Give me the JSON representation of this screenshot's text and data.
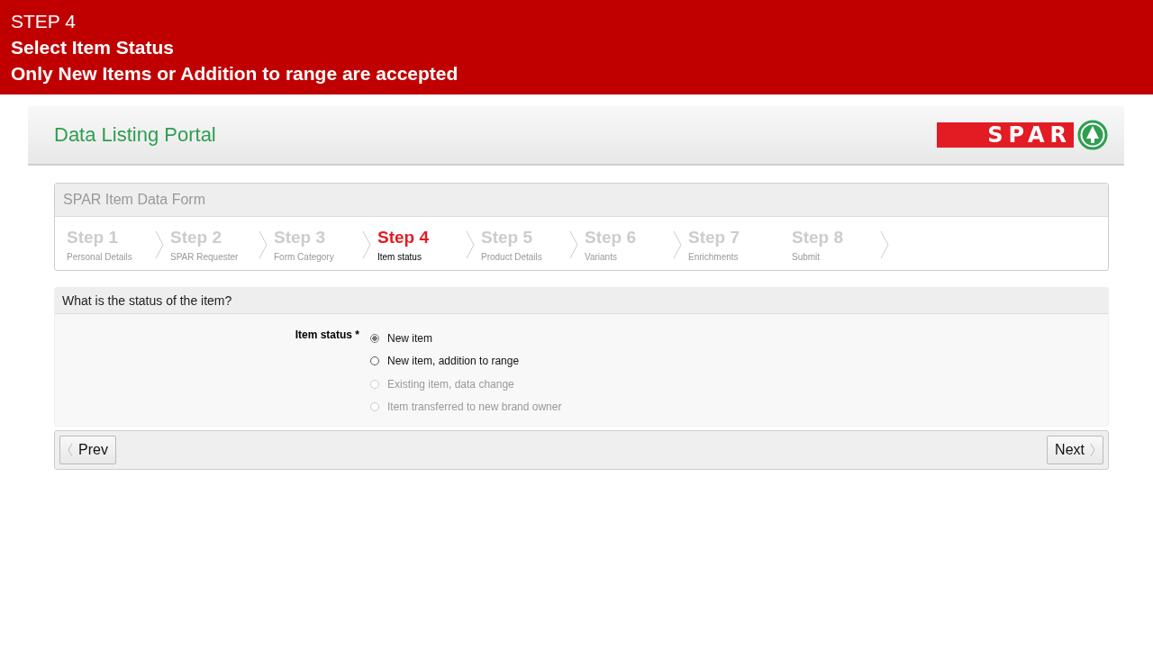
{
  "banner": {
    "lines": [
      {
        "text": "STEP 4",
        "bold": false
      },
      {
        "text": "Select Item Status",
        "bold": true
      },
      {
        "text": "Only New Items or Addition to range are accepted",
        "bold": true
      }
    ]
  },
  "header": {
    "title": "Data Listing Portal",
    "logo_text": "SPAR"
  },
  "form": {
    "title": "SPAR Item Data Form",
    "steps": [
      {
        "label": "Step 1",
        "caption": "Personal Details",
        "selected": false,
        "arrow_after": true
      },
      {
        "label": "Step 2",
        "caption": "SPAR Requester",
        "selected": false,
        "arrow_after": true
      },
      {
        "label": "Step 3",
        "caption": "Form Category",
        "selected": false,
        "arrow_after": true
      },
      {
        "label": "Step 4",
        "caption": "Item status",
        "selected": true,
        "arrow_after": true
      },
      {
        "label": "Step 5",
        "caption": "Product Details",
        "selected": false,
        "arrow_after": true
      },
      {
        "label": "Step 6",
        "caption": "Variants",
        "selected": false,
        "arrow_after": true
      },
      {
        "label": "Step 7",
        "caption": "Enrichments",
        "selected": false,
        "arrow_after": false
      },
      {
        "label": "Step 8",
        "caption": "Submit",
        "selected": false,
        "arrow_after": true
      }
    ]
  },
  "question": {
    "title": "What is the status of the item?",
    "field_label": "Item status *",
    "options": [
      {
        "label": "New item",
        "selected": true,
        "disabled": false
      },
      {
        "label": "New item, addition to range",
        "selected": false,
        "disabled": false
      },
      {
        "label": "Existing item, data change",
        "selected": false,
        "disabled": true
      },
      {
        "label": "Item transferred to new brand owner",
        "selected": false,
        "disabled": true
      }
    ]
  },
  "nav": {
    "prev": "Prev",
    "next": "Next"
  }
}
